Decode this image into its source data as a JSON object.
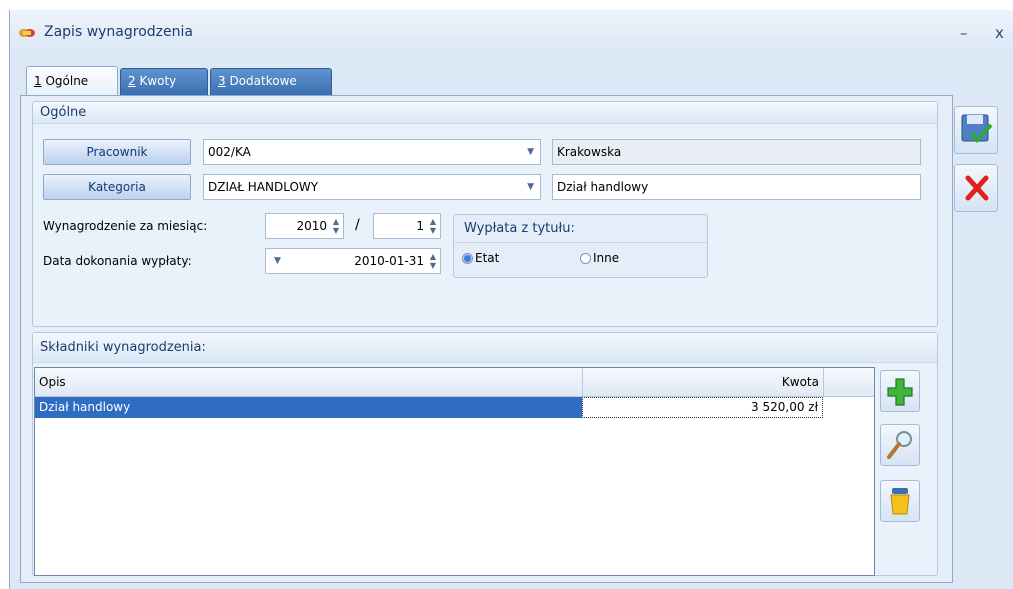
{
  "window": {
    "title": "Zapis wynagrodzenia",
    "minimize": "–",
    "close": "x"
  },
  "tabs": [
    {
      "num": "1",
      "label": " Ogólne"
    },
    {
      "num": "2",
      "label": " Kwoty"
    },
    {
      "num": "3",
      "label": " Dodatkowe"
    }
  ],
  "general": {
    "caption": "Ogólne",
    "employee_button": "Pracownik",
    "employee_code": "002/KA",
    "employee_name": "Krakowska",
    "category_button": "Kategoria",
    "category_code": "DZIAŁ HANDLOWY",
    "category_name": "Dział handlowy",
    "month_label": "Wynagrodzenie za miesiąc:",
    "year_value": "2010",
    "slash": "/",
    "month_value": "1",
    "date_label": "Data dokonania wypłaty:",
    "date_value": "2010-01-31",
    "payout_caption": "Wypłata z tytułu:",
    "radio_etat": "Etat",
    "radio_inne": "Inne",
    "selected": "Etat"
  },
  "components": {
    "caption": "Składniki wynagrodzenia:",
    "columns": [
      "Opis",
      "Kwota"
    ],
    "rows": [
      {
        "opis": "Dział handlowy",
        "kwota": "3 520,00 zł"
      }
    ]
  },
  "icons": [
    "save-icon",
    "cancel-icon",
    "add-icon",
    "view-icon",
    "delete-icon",
    "title-app-icon",
    "dropdown-arrow-icon",
    "spin-arrows-icon"
  ],
  "colors": {
    "accent": "#2f6dc3",
    "tab_blue": "#3a6fb2",
    "cancel_red": "#e0201a",
    "add_green": "#3fb53b"
  }
}
